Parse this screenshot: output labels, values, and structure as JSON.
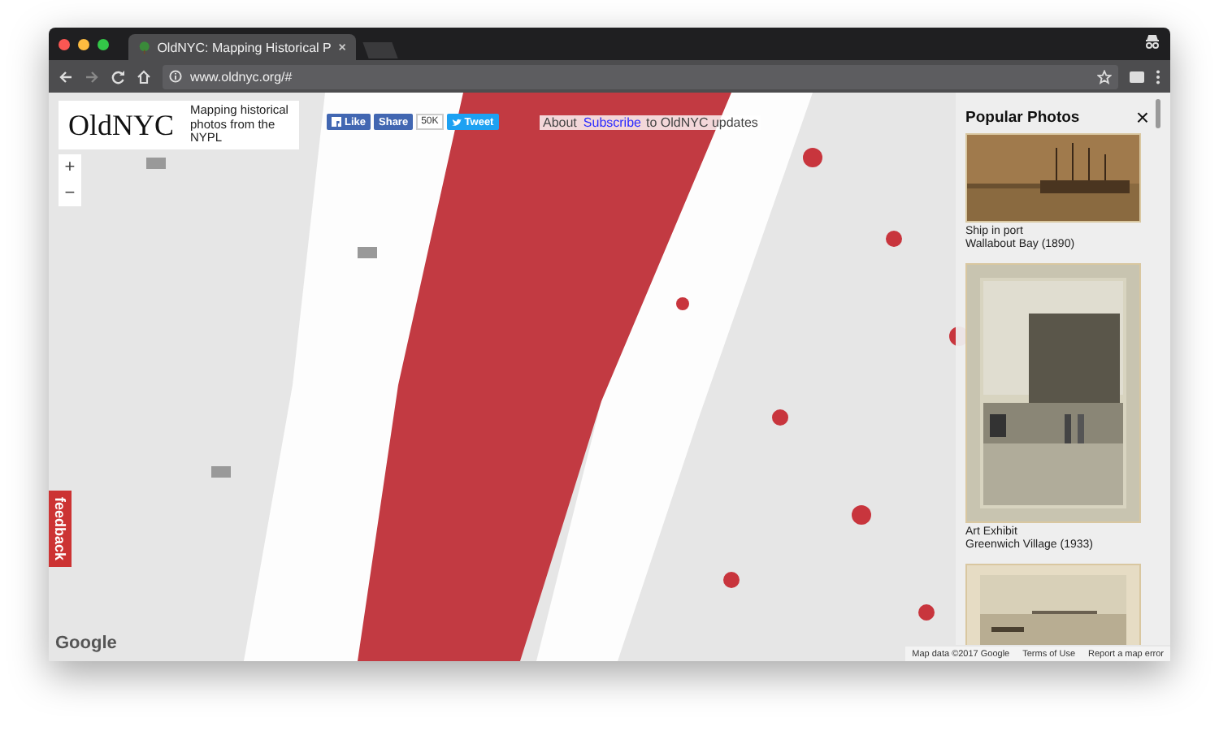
{
  "browser": {
    "tab_title": "OldNYC: Mapping Historical P",
    "address": "www.oldnyc.org/#"
  },
  "header": {
    "logo": "OldNYC",
    "tagline": "Mapping historical photos from the NYPL"
  },
  "social": {
    "like": "Like",
    "share": "Share",
    "count": "50K",
    "tweet": "Tweet"
  },
  "links": {
    "about": "About",
    "subscribe_link": "Subscribe",
    "subscribe_rest": "to OldNYC updates"
  },
  "zoom": {
    "plus": "+",
    "minus": "−"
  },
  "feedback": "feedback",
  "sidebar": {
    "title": "Popular Photos",
    "close": "×",
    "photos": [
      {
        "kind": "ship",
        "title": "Ship in port",
        "place": "Wallabout Bay (1890)"
      },
      {
        "kind": "street",
        "title": "Art Exhibit",
        "place": "Greenwich Village (1933)"
      },
      {
        "kind": "harbor"
      }
    ]
  },
  "map": {
    "logo": "Google",
    "attribution": "Map data ©2017 Google",
    "terms": "Terms of Use",
    "report": "Report a map error"
  }
}
